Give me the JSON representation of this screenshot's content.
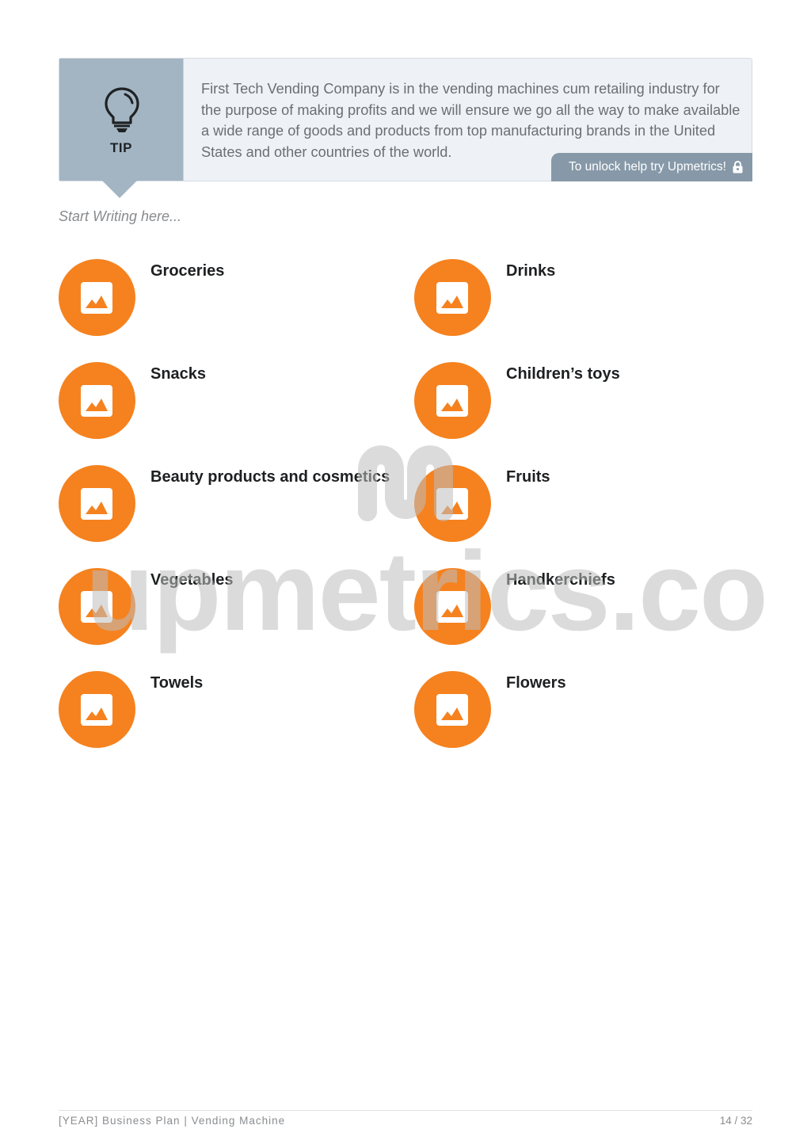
{
  "tip": {
    "label": "TIP",
    "icon": "lightbulb-icon",
    "text": "First Tech Vending Company is in the vending machines cum retailing industry for the purpose of making profits and we will ensure we go all the way to make available a wide range of goods and products from top manufacturing brands in the United States and other countries of the world.",
    "unlock_label": "To unlock help try Upmetrics!",
    "unlock_icon": "lock-icon"
  },
  "start_writing_placeholder": "Start Writing here...",
  "watermark": "upmetrics.co",
  "items": [
    {
      "label": "Groceries",
      "icon": "image-icon"
    },
    {
      "label": "Drinks",
      "icon": "image-icon"
    },
    {
      "label": "Snacks",
      "icon": "image-icon"
    },
    {
      "label": "Children’s toys",
      "icon": "image-icon"
    },
    {
      "label": "Beauty products and cosmetics",
      "icon": "image-icon"
    },
    {
      "label": "Fruits",
      "icon": "image-icon"
    },
    {
      "label": "Vegetables",
      "icon": "image-icon"
    },
    {
      "label": "Handkerchiefs",
      "icon": "image-icon"
    },
    {
      "label": "Towels",
      "icon": "image-icon"
    },
    {
      "label": "Flowers",
      "icon": "image-icon"
    }
  ],
  "colors": {
    "accent": "#f5821f",
    "tip_panel": "#a3b5c3",
    "tip_background": "#eef2f7",
    "unlock_background": "#8799a8"
  },
  "footer": {
    "title": "[YEAR] Business Plan | Vending Machine",
    "page": "14 / 32"
  }
}
